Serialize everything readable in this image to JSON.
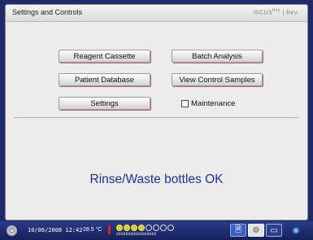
{
  "window": {
    "title": "Settings and Controls",
    "logo_text": "ISCUS",
    "logo_sup": "flex",
    "logo_suffix": "| Rev."
  },
  "buttons": {
    "reagent_cassette": "Reagent Cassette",
    "batch_analysis": "Batch Analysis",
    "patient_database": "Patient Database",
    "view_control_samples": "View Control Samples",
    "settings": "Settings"
  },
  "maintenance": {
    "label": "Maintenance",
    "checked": false
  },
  "status_message": "Rinse/Waste bottles OK",
  "taskbar": {
    "datetime": "10/06/2008 12:42",
    "temperature": "28.5 °C",
    "tray_sub": "00000000000000000"
  },
  "colors": {
    "accent": "#20309a",
    "taskbar": "#1d2b6b",
    "indicator": "#d8d020"
  },
  "icons": [
    "power-icon",
    "thermometer-icon",
    "document-icon",
    "settings-gear-icon",
    "monitor-icon",
    "globe-icon"
  ]
}
